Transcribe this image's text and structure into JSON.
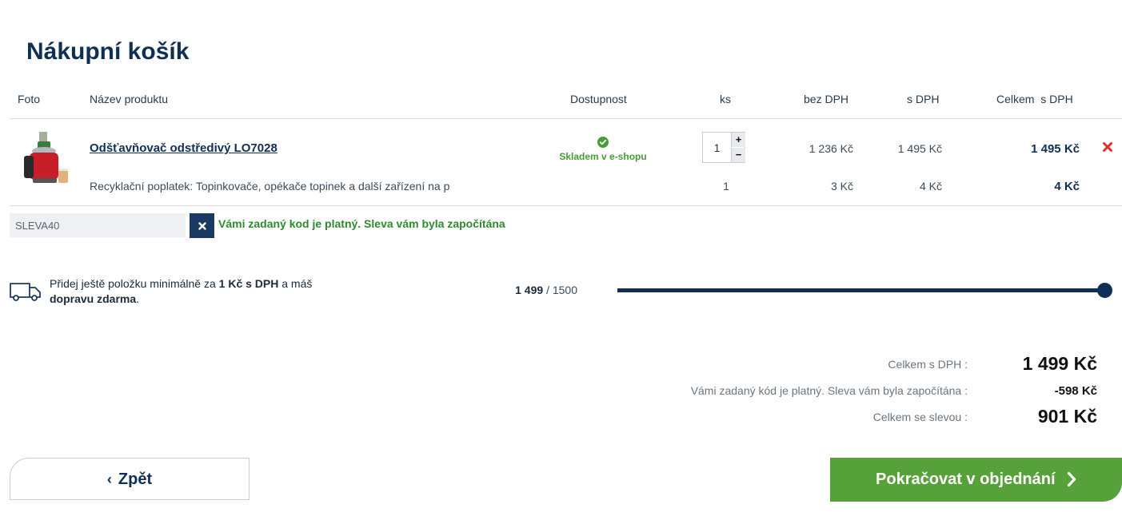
{
  "page_title": "Nákupní košík",
  "table_headers": {
    "foto": "Foto",
    "name": "Název produktu",
    "availability": "Dostupnost",
    "qty": "ks",
    "price_no_vat": "bez DPH",
    "price_vat": "s DPH",
    "total_vat": "Celkem  s DPH"
  },
  "item": {
    "name": "Odšťavňovač odstředivý LO7028",
    "availability": "Skladem v e-shopu",
    "quantity": "1",
    "price_no_vat": "1 236 Kč",
    "price_vat": "1 495 Kč",
    "total": "1 495 Kč",
    "image_icon": "juicer-product-image",
    "remove_icon": "close-icon"
  },
  "fee": {
    "label": "Recyklační poplatek:  Topinkovače, opékače topinek a další zařízení na p",
    "quantity": "1",
    "price_no_vat": "3 Kč",
    "price_vat": "4 Kč",
    "total": "4 Kč"
  },
  "coupon": {
    "value": "SLEVA40",
    "remove_icon": "close-icon",
    "message": "Vámi zadaný kod je platný. Sleva vám byla započítána"
  },
  "shipping": {
    "text_before": "Přidej ještě položku minimálně za ",
    "amount": "1 Kč s DPH",
    "text_middle": " a máš ",
    "free": "dopravu zdarma",
    "text_after": ".",
    "current": "1 499",
    "target": "/ 1500",
    "progress": 0.999,
    "icon": "truck-icon"
  },
  "summary": {
    "total_label": "Celkem s DPH :",
    "total_value": "1 499 Kč",
    "discount_label": "Vámi zadaný kód je platný. Sleva vám byla započítána :",
    "discount_value": "-598 Kč",
    "final_label": "Celkem se slevou :",
    "final_value": "901 Kč"
  },
  "buttons": {
    "back": "Zpět",
    "continue": "Pokračovat v objednání"
  },
  "colors": {
    "primary": "#0f2f55",
    "success": "#56a13a",
    "remove": "#d93030"
  }
}
